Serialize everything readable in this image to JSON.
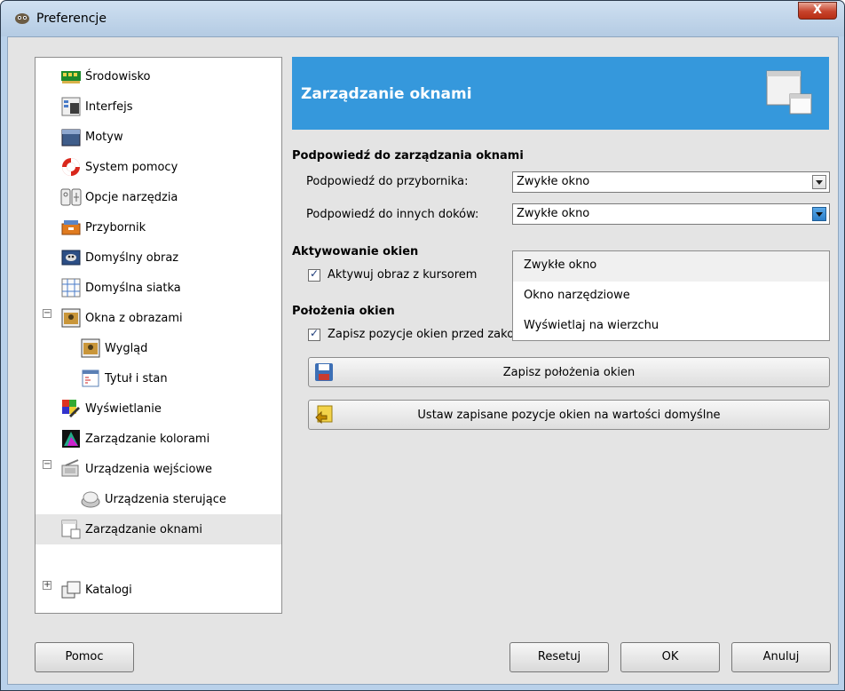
{
  "window": {
    "title": "Preferencje",
    "close_label": "X"
  },
  "sidebar": {
    "items": [
      {
        "label": "Środowisko",
        "icon": "memory-chip-icon"
      },
      {
        "label": "Interfejs",
        "icon": "interface-icon"
      },
      {
        "label": "Motyw",
        "icon": "theme-icon"
      },
      {
        "label": "System pomocy",
        "icon": "lifebuoy-icon"
      },
      {
        "label": "Opcje narzędzia",
        "icon": "tool-options-icon"
      },
      {
        "label": "Przybornik",
        "icon": "toolbox-icon"
      },
      {
        "label": "Domyślny obraz",
        "icon": "default-image-icon"
      },
      {
        "label": "Domyślna siatka",
        "icon": "grid-icon"
      },
      {
        "label": "Okna z obrazami",
        "icon": "image-window-icon",
        "expander": "−"
      },
      {
        "label": "Wygląd",
        "icon": "appearance-icon"
      },
      {
        "label": "Tytuł i stan",
        "icon": "title-status-icon"
      },
      {
        "label": "Wyświetlanie",
        "icon": "display-icon"
      },
      {
        "label": "Zarządzanie kolorami",
        "icon": "color-management-icon"
      },
      {
        "label": "Urządzenia wejściowe",
        "icon": "input-devices-icon",
        "expander": "−"
      },
      {
        "label": "Urządzenia sterujące",
        "icon": "controllers-icon"
      },
      {
        "label": "Zarządzanie oknami",
        "icon": "window-management-icon",
        "selected": true
      },
      {
        "label": "Katalogi",
        "icon": "folders-icon",
        "expander": "+"
      }
    ]
  },
  "banner": {
    "title": "Zarządzanie oknami",
    "icon": "window-management-icon"
  },
  "hints": {
    "heading": "Podpowiedź do zarządzania oknami",
    "toolbox_label": "Podpowiedź do przybornika:",
    "toolbox_value": "Zwykłe okno",
    "docks_label": "Podpowiedź do innych doków:",
    "docks_value": "Zwykłe okno",
    "options": [
      "Zwykłe okno",
      "Okno narzędziowe",
      "Wyświetlaj na wierzchu"
    ]
  },
  "focus": {
    "heading": "Aktywowanie okien",
    "activate_label": "Aktywuj obraz z kursorem",
    "activate_checked": true
  },
  "positions": {
    "heading": "Położenia okien",
    "save_on_exit_label": "Zapisz pozycje okien przed zakończeniem",
    "save_on_exit_checked": true,
    "save_now_label": "Zapisz położenia okien",
    "reset_label": "Ustaw zapisane pozycje okien na wartości domyślne"
  },
  "buttons": {
    "help": "Pomoc",
    "reset": "Resetuj",
    "ok": "OK",
    "cancel": "Anuluj"
  },
  "colors": {
    "banner": "#3598dc",
    "window_frame": "#b9d1ea",
    "close": "#c7432c"
  }
}
